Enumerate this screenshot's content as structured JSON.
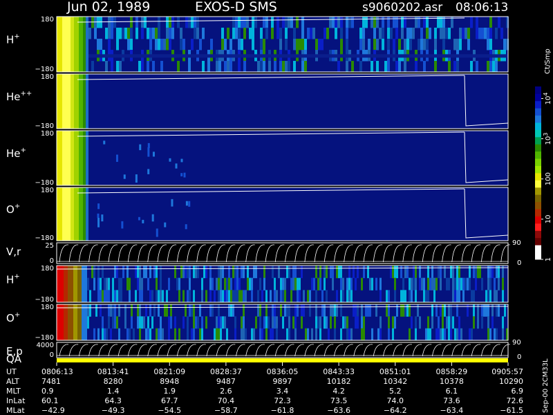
{
  "header": {
    "date": "Jun 02, 1989",
    "instrument": "EXOS-D SMS",
    "file": "s9060202.asr",
    "time": "08:06:13"
  },
  "colorbar": {
    "unit_label": "Ct/Smp",
    "ticks": [
      {
        "label": "10",
        "sup": "4",
        "value": 10000
      },
      {
        "label": "10",
        "sup": "3",
        "value": 1000
      },
      {
        "label": "100",
        "sup": "",
        "value": 100
      },
      {
        "label": "10",
        "sup": "",
        "value": 10
      },
      {
        "label": "1",
        "sup": "",
        "value": 1
      }
    ],
    "colors": [
      "#000080",
      "#00009c",
      "#0a1ec8",
      "#1450d2",
      "#1e78dc",
      "#00b4dc",
      "#00c8b4",
      "#00a050",
      "#2a8a00",
      "#50b400",
      "#7ad200",
      "#a0e600",
      "#e6e600",
      "#ffff3c",
      "#a09600",
      "#786400",
      "#8c5000",
      "#b42800",
      "#dc0000",
      "#ff1e1e",
      "#8c0a0a",
      "#640000",
      "#ffffff",
      "#ffffff"
    ]
  },
  "side_note": "Sep-00  2CM33L",
  "chart_data": {
    "type": "heatmap",
    "title": "Jun 02, 1989   EXOS-D SMS",
    "x_axis": {
      "times": [
        "0806:13",
        "0813:41",
        "0821:09",
        "0828:37",
        "0836:05",
        "0843:33",
        "0851:01",
        "0858:29",
        "0905:57"
      ]
    },
    "panels": [
      {
        "id": "h-plus-1",
        "label": "H",
        "sup": "+",
        "kind": "spectrogram",
        "ylim": [
          -180,
          180
        ],
        "ticks": [
          "180",
          "−180"
        ],
        "pattern": "hplus1"
      },
      {
        "id": "he-plus-plus",
        "label": "He",
        "sup": "++",
        "kind": "spectrogram",
        "ylim": [
          -180,
          180
        ],
        "ticks": [
          "180",
          "−180"
        ],
        "pattern": "helium"
      },
      {
        "id": "he-plus",
        "label": "He",
        "sup": "+",
        "kind": "spectrogram",
        "ylim": [
          -180,
          180
        ],
        "ticks": [
          "180",
          "−180"
        ],
        "pattern": "heplus"
      },
      {
        "id": "o-plus-1",
        "label": "O",
        "sup": "+",
        "kind": "spectrogram",
        "ylim": [
          -180,
          180
        ],
        "ticks": [
          "180",
          "−180"
        ],
        "pattern": "oplus1"
      },
      {
        "id": "v-r",
        "label": "V,r",
        "sup": "",
        "kind": "line",
        "ylim": [
          0,
          25
        ],
        "ticks": [
          "25",
          "0"
        ],
        "right_ticks": [
          "90",
          "0"
        ]
      },
      {
        "id": "h-plus-2",
        "label": "H",
        "sup": "+",
        "kind": "spectrogram",
        "ylim": [
          -180,
          180
        ],
        "ticks": [
          "180",
          "−180"
        ],
        "pattern": "striped"
      },
      {
        "id": "o-plus-2",
        "label": "O",
        "sup": "+",
        "kind": "spectrogram",
        "ylim": [
          -180,
          180
        ],
        "ticks": [
          "180",
          "−180"
        ],
        "pattern": "striped"
      },
      {
        "id": "e-p",
        "label": "E,p",
        "sup": "",
        "kind": "line",
        "ylim": [
          0,
          4000
        ],
        "ticks": [
          "4000",
          "0"
        ],
        "right_ticks": [
          "90",
          "0"
        ]
      },
      {
        "id": "qa",
        "label": "QA",
        "sup": "",
        "kind": "bar",
        "ticks": []
      }
    ],
    "ephemeris": [
      {
        "name": "UT",
        "values": [
          "0806:13",
          "0813:41",
          "0821:09",
          "0828:37",
          "0836:05",
          "0843:33",
          "0851:01",
          "0858:29",
          "0905:57"
        ]
      },
      {
        "name": "ALT",
        "values": [
          "7481",
          "8280",
          "8948",
          "9487",
          "9897",
          "10182",
          "10342",
          "10378",
          "10290"
        ]
      },
      {
        "name": "MLT",
        "values": [
          "0.9",
          "1.4",
          "1.9",
          "2.6",
          "3.4",
          "4.2",
          "5.2",
          "6.1",
          "6.9"
        ]
      },
      {
        "name": "InLat",
        "values": [
          "60.1",
          "64.3",
          "67.7",
          "70.4",
          "72.3",
          "73.5",
          "74.0",
          "73.6",
          "72.6"
        ]
      },
      {
        "name": "MLat",
        "values": [
          "−42.9",
          "−49.3",
          "−54.5",
          "−58.7",
          "−61.8",
          "−63.6",
          "−64.2",
          "−63.4",
          "−61.5"
        ]
      }
    ]
  }
}
